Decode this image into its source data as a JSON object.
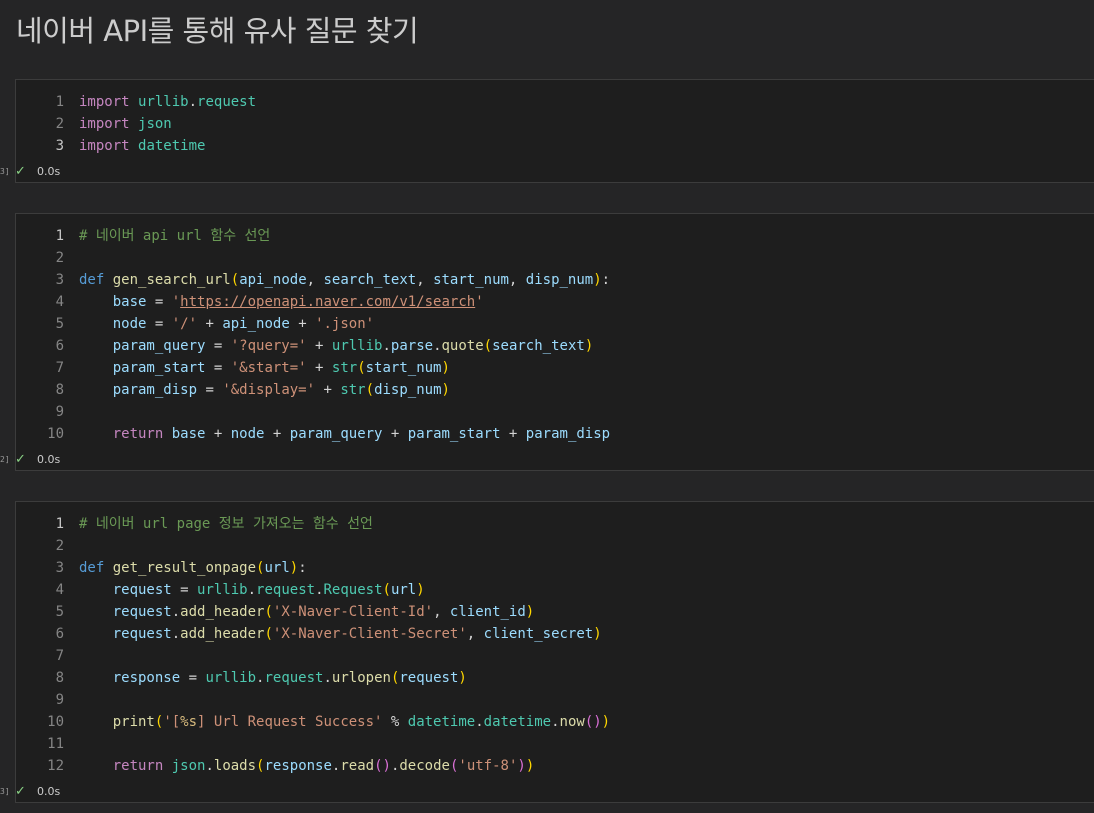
{
  "page_title": "네이버 API를 통해 유사 질문 찾기",
  "cells": [
    {
      "exec_count": "3]",
      "status": "0.0s",
      "lines": [
        {
          "n": "1",
          "tokens": [
            [
              "kw2",
              "import"
            ],
            [
              "op",
              " "
            ],
            [
              "mod",
              "urllib"
            ],
            [
              "op",
              "."
            ],
            [
              "mod",
              "request"
            ]
          ]
        },
        {
          "n": "2",
          "tokens": [
            [
              "kw2",
              "import"
            ],
            [
              "op",
              " "
            ],
            [
              "mod",
              "json"
            ]
          ]
        },
        {
          "n": "3",
          "tokens": [
            [
              "kw2",
              "import"
            ],
            [
              "op",
              " "
            ],
            [
              "mod",
              "datetime"
            ]
          ]
        }
      ]
    },
    {
      "exec_count": "2]",
      "status": "0.0s",
      "lines": [
        {
          "n": "1",
          "tokens": [
            [
              "cm",
              "# 네이버 api url 함수 선언"
            ]
          ]
        },
        {
          "n": "2",
          "tokens": []
        },
        {
          "n": "3",
          "tokens": [
            [
              "kw",
              "def"
            ],
            [
              "op",
              " "
            ],
            [
              "fn",
              "gen_search_url"
            ],
            [
              "b1",
              "("
            ],
            [
              "var",
              "api_node"
            ],
            [
              "op",
              ", "
            ],
            [
              "var",
              "search_text"
            ],
            [
              "op",
              ", "
            ],
            [
              "var",
              "start_num"
            ],
            [
              "op",
              ", "
            ],
            [
              "var",
              "disp_num"
            ],
            [
              "b1",
              ")"
            ],
            [
              "op",
              ":"
            ]
          ]
        },
        {
          "n": "4",
          "tokens": [
            [
              "op",
              "    "
            ],
            [
              "var",
              "base"
            ],
            [
              "op",
              " = "
            ],
            [
              "str",
              "'"
            ],
            [
              "url",
              "https://openapi.naver.com/v1/search"
            ],
            [
              "str",
              "'"
            ]
          ]
        },
        {
          "n": "5",
          "tokens": [
            [
              "op",
              "    "
            ],
            [
              "var",
              "node"
            ],
            [
              "op",
              " = "
            ],
            [
              "str",
              "'/'"
            ],
            [
              "op",
              " + "
            ],
            [
              "var",
              "api_node"
            ],
            [
              "op",
              " + "
            ],
            [
              "str",
              "'.json'"
            ]
          ]
        },
        {
          "n": "6",
          "tokens": [
            [
              "op",
              "    "
            ],
            [
              "var",
              "param_query"
            ],
            [
              "op",
              " = "
            ],
            [
              "str",
              "'?query='"
            ],
            [
              "op",
              " + "
            ],
            [
              "mod",
              "urllib"
            ],
            [
              "op",
              "."
            ],
            [
              "var",
              "parse"
            ],
            [
              "op",
              "."
            ],
            [
              "fn",
              "quote"
            ],
            [
              "b1",
              "("
            ],
            [
              "var",
              "search_text"
            ],
            [
              "b1",
              ")"
            ]
          ]
        },
        {
          "n": "7",
          "tokens": [
            [
              "op",
              "    "
            ],
            [
              "var",
              "param_start"
            ],
            [
              "op",
              " = "
            ],
            [
              "str",
              "'&start='"
            ],
            [
              "op",
              " + "
            ],
            [
              "mod",
              "str"
            ],
            [
              "b1",
              "("
            ],
            [
              "var",
              "start_num"
            ],
            [
              "b1",
              ")"
            ]
          ]
        },
        {
          "n": "8",
          "tokens": [
            [
              "op",
              "    "
            ],
            [
              "var",
              "param_disp"
            ],
            [
              "op",
              " = "
            ],
            [
              "str",
              "'&display='"
            ],
            [
              "op",
              " + "
            ],
            [
              "mod",
              "str"
            ],
            [
              "b1",
              "("
            ],
            [
              "var",
              "disp_num"
            ],
            [
              "b1",
              ")"
            ]
          ]
        },
        {
          "n": "9",
          "tokens": []
        },
        {
          "n": "10",
          "tokens": [
            [
              "op",
              "    "
            ],
            [
              "kw2",
              "return"
            ],
            [
              "op",
              " "
            ],
            [
              "var",
              "base"
            ],
            [
              "op",
              " + "
            ],
            [
              "var",
              "node"
            ],
            [
              "op",
              " + "
            ],
            [
              "var",
              "param_query"
            ],
            [
              "op",
              " + "
            ],
            [
              "var",
              "param_start"
            ],
            [
              "op",
              " + "
            ],
            [
              "var",
              "param_disp"
            ]
          ]
        }
      ]
    },
    {
      "exec_count": "3]",
      "status": "0.0s",
      "lines": [
        {
          "n": "1",
          "tokens": [
            [
              "cm",
              "# 네이버 url page 정보 가져오는 함수 선언"
            ]
          ]
        },
        {
          "n": "2",
          "tokens": []
        },
        {
          "n": "3",
          "tokens": [
            [
              "kw",
              "def"
            ],
            [
              "op",
              " "
            ],
            [
              "fn",
              "get_result_onpage"
            ],
            [
              "b1",
              "("
            ],
            [
              "var",
              "url"
            ],
            [
              "b1",
              ")"
            ],
            [
              "op",
              ":"
            ]
          ]
        },
        {
          "n": "4",
          "tokens": [
            [
              "op",
              "    "
            ],
            [
              "var",
              "request"
            ],
            [
              "op",
              " = "
            ],
            [
              "mod",
              "urllib"
            ],
            [
              "op",
              "."
            ],
            [
              "mod",
              "request"
            ],
            [
              "op",
              "."
            ],
            [
              "mod",
              "Request"
            ],
            [
              "b1",
              "("
            ],
            [
              "var",
              "url"
            ],
            [
              "b1",
              ")"
            ]
          ]
        },
        {
          "n": "5",
          "tokens": [
            [
              "op",
              "    "
            ],
            [
              "var",
              "request"
            ],
            [
              "op",
              "."
            ],
            [
              "fn",
              "add_header"
            ],
            [
              "b1",
              "("
            ],
            [
              "str",
              "'X-Naver-Client-Id'"
            ],
            [
              "op",
              ", "
            ],
            [
              "var",
              "client_id"
            ],
            [
              "b1",
              ")"
            ]
          ]
        },
        {
          "n": "6",
          "tokens": [
            [
              "op",
              "    "
            ],
            [
              "var",
              "request"
            ],
            [
              "op",
              "."
            ],
            [
              "fn",
              "add_header"
            ],
            [
              "b1",
              "("
            ],
            [
              "str",
              "'X-Naver-Client-Secret'"
            ],
            [
              "op",
              ", "
            ],
            [
              "var",
              "client_secret"
            ],
            [
              "b1",
              ")"
            ]
          ]
        },
        {
          "n": "7",
          "tokens": []
        },
        {
          "n": "8",
          "tokens": [
            [
              "op",
              "    "
            ],
            [
              "var",
              "response"
            ],
            [
              "op",
              " = "
            ],
            [
              "mod",
              "urllib"
            ],
            [
              "op",
              "."
            ],
            [
              "mod",
              "request"
            ],
            [
              "op",
              "."
            ],
            [
              "fn",
              "urlopen"
            ],
            [
              "b1",
              "("
            ],
            [
              "var",
              "request"
            ],
            [
              "b1",
              ")"
            ]
          ]
        },
        {
          "n": "9",
          "tokens": []
        },
        {
          "n": "10",
          "tokens": [
            [
              "op",
              "    "
            ],
            [
              "fn",
              "print"
            ],
            [
              "b1",
              "("
            ],
            [
              "str",
              "'["
            ],
            [
              "esc",
              "%s"
            ],
            [
              "str",
              "] Url Request Success'"
            ],
            [
              "op",
              " % "
            ],
            [
              "mod",
              "datetime"
            ],
            [
              "op",
              "."
            ],
            [
              "mod",
              "datetime"
            ],
            [
              "op",
              "."
            ],
            [
              "fn",
              "now"
            ],
            [
              "b2",
              "()"
            ],
            [
              "b1",
              ")"
            ]
          ]
        },
        {
          "n": "11",
          "tokens": []
        },
        {
          "n": "12",
          "tokens": [
            [
              "op",
              "    "
            ],
            [
              "kw2",
              "return"
            ],
            [
              "op",
              " "
            ],
            [
              "mod",
              "json"
            ],
            [
              "op",
              "."
            ],
            [
              "fn",
              "loads"
            ],
            [
              "b1",
              "("
            ],
            [
              "var",
              "response"
            ],
            [
              "op",
              "."
            ],
            [
              "fn",
              "read"
            ],
            [
              "b2",
              "()"
            ],
            [
              "op",
              "."
            ],
            [
              "fn",
              "decode"
            ],
            [
              "b2",
              "("
            ],
            [
              "str",
              "'utf-8'"
            ],
            [
              "b2",
              ")"
            ],
            [
              "b1",
              ")"
            ]
          ]
        }
      ]
    }
  ]
}
